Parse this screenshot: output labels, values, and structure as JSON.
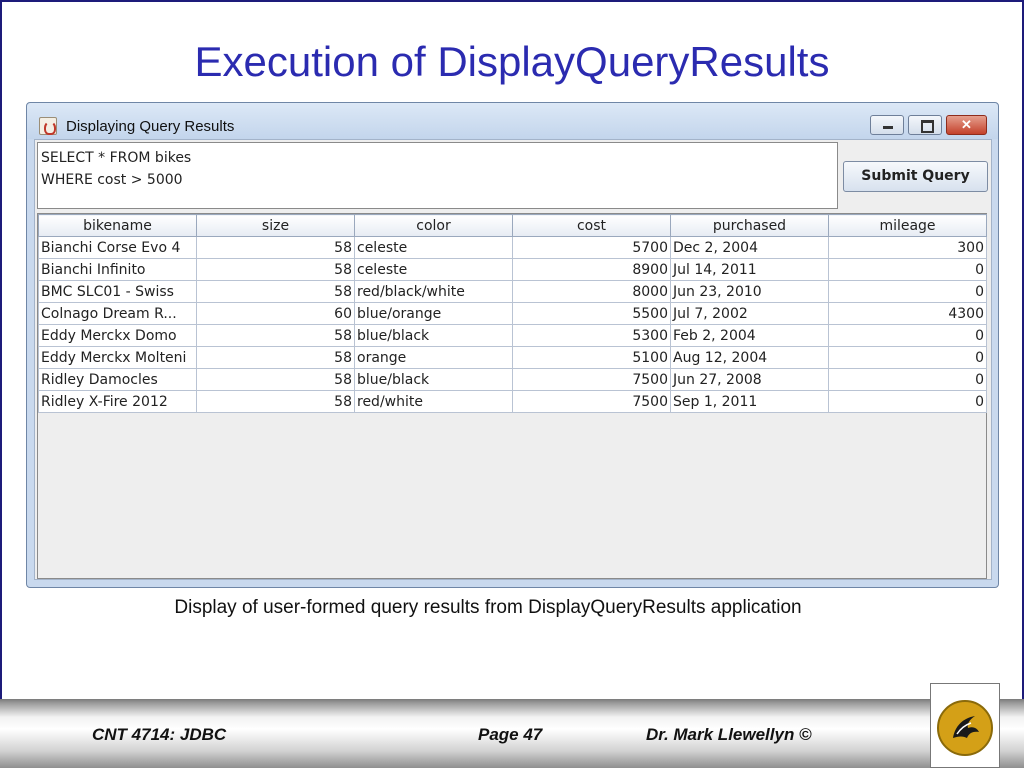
{
  "slide": {
    "title": "Execution of DisplayQueryResults",
    "caption": "Display of user-formed query results from DisplayQueryResults application"
  },
  "window": {
    "title": "Displaying Query Results",
    "query_lines": [
      "SELECT * FROM bikes",
      "WHERE cost > 5000"
    ],
    "submit_label": "Submit Query"
  },
  "table": {
    "columns": [
      "bikename",
      "size",
      "color",
      "cost",
      "purchased",
      "mileage"
    ],
    "rows": [
      [
        "Bianchi Corse Evo 4",
        "58",
        "celeste",
        "5700",
        "Dec 2, 2004",
        "300"
      ],
      [
        "Bianchi Infinito",
        "58",
        "celeste",
        "8900",
        "Jul 14, 2011",
        "0"
      ],
      [
        "BMC SLC01 - Swiss",
        "58",
        "red/black/white",
        "8000",
        "Jun 23, 2010",
        "0"
      ],
      [
        "Colnago Dream R...",
        "60",
        "blue/orange",
        "5500",
        "Jul 7, 2002",
        "4300"
      ],
      [
        "Eddy Merckx Domo",
        "58",
        "blue/black",
        "5300",
        "Feb 2, 2004",
        "0"
      ],
      [
        "Eddy Merckx Molteni",
        "58",
        "orange",
        "5100",
        "Aug 12, 2004",
        "0"
      ],
      [
        "Ridley Damocles",
        "58",
        "blue/black",
        "7500",
        "Jun 27, 2008",
        "0"
      ],
      [
        "Ridley X-Fire 2012",
        "58",
        "red/white",
        "7500",
        "Sep 1, 2011",
        "0"
      ]
    ]
  },
  "footer": {
    "course": "CNT 4714: JDBC",
    "page": "Page 47",
    "author": "Dr. Mark Llewellyn ©"
  },
  "icons": {
    "app": "java-cup-icon",
    "minimize": "minimize-icon",
    "maximize": "maximize-icon",
    "close": "close-icon",
    "logo": "ucf-pegasus-logo-icon"
  },
  "colors": {
    "title": "#2b2bb0",
    "close_button": "#c3412b",
    "logo_gold": "#d4a017"
  }
}
